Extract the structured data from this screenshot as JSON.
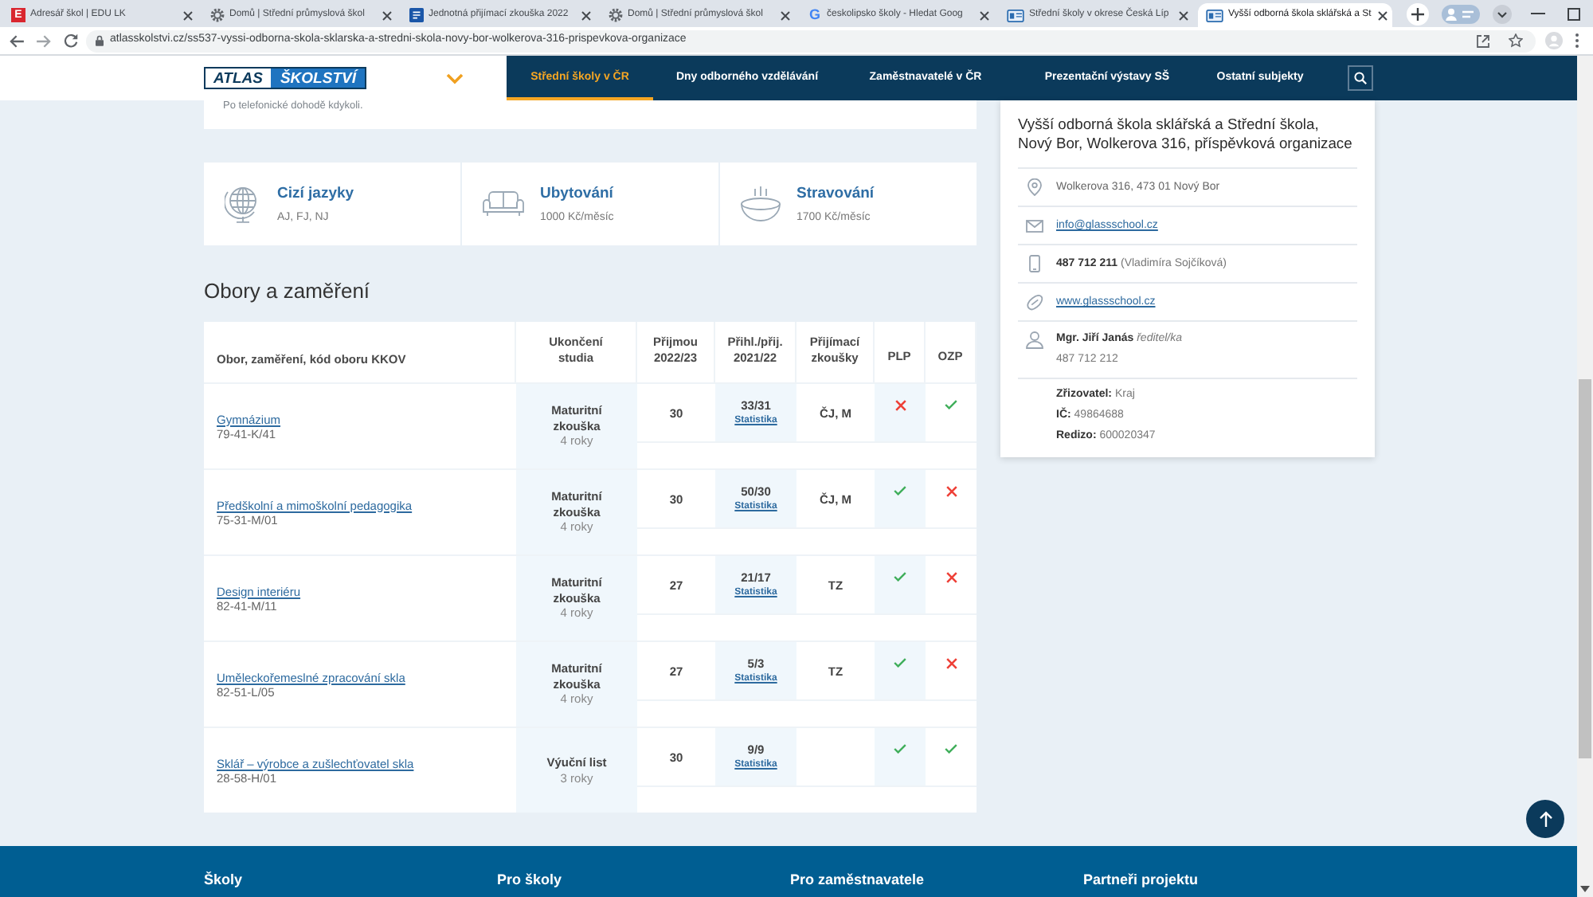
{
  "browser": {
    "tabs": [
      {
        "title": "Adresář škol | EDU LK",
        "kind": "badge",
        "icon_text": "E",
        "selected": false
      },
      {
        "title": "Domů | Střední průmyslová škol",
        "kind": "gear",
        "selected": false
      },
      {
        "title": "Jednotná přijímací zkouška 2022",
        "kind": "page",
        "selected": false
      },
      {
        "title": "Domů | Střední průmyslová škol",
        "kind": "gear",
        "selected": false
      },
      {
        "title": "českolipsko školy - Hledat Goog",
        "kind": "google",
        "icon_text": "G",
        "selected": false
      },
      {
        "title": "Střední školy v okrese Česká Líp",
        "kind": "card",
        "selected": false
      },
      {
        "title": "Vyšší odborná škola sklářská a St",
        "kind": "card",
        "selected": true
      }
    ],
    "address": "atlasskolstvi.cz/ss537-vyssi-odborna-skola-sklarska-a-stredni-skola-novy-bor-wolkerova-316-prispevkova-organizace"
  },
  "header": {
    "logo": {
      "part_1": "ATLAS",
      "part_2": "ŠKOLSTVÍ"
    },
    "menu": [
      {
        "label": "Střední školy v ČR",
        "selected": true
      },
      {
        "label": "Dny odborného vzdělávání",
        "selected": false
      },
      {
        "label": "Zaměstnavatelé v ČR",
        "selected": false
      },
      {
        "label": "Prezentační výstavy SŠ",
        "selected": false
      },
      {
        "label": "Ostatní subjekty",
        "selected": false
      }
    ]
  },
  "intro_note": "Po telefonické dohodě kdykoli.",
  "facilities": [
    {
      "kind": "languages",
      "title": "Cizí jazyky",
      "value": "AJ, FJ, NJ"
    },
    {
      "kind": "accommodation",
      "title": "Ubytování",
      "value": "1000 Kč/měsíc"
    },
    {
      "kind": "meals",
      "title": "Stravování",
      "value": "1700 Kč/měsíc"
    }
  ],
  "programs": {
    "heading": "Obory a zaměření",
    "columns": [
      "Obor, zaměření, kód oboru KKOV",
      "Ukončení studia",
      "Přijmou 2022/23",
      "Přihl./přij. 2021/22",
      "Přijímací zkoušky",
      "PLP",
      "OZP"
    ],
    "rows": [
      {
        "name": "Gymnázium",
        "code": "79-41-K/41",
        "completion": "Maturitní zkouška",
        "duration": "4 roky",
        "capacity": "30",
        "applicants": "33/31",
        "stats_link": "Statistika",
        "exams": "ČJ, M",
        "plp": false,
        "ozp": true
      },
      {
        "name": "Předškolní a mimoškolní pedagogika",
        "code": "75-31-M/01",
        "completion": "Maturitní zkouška",
        "duration": "4 roky",
        "capacity": "30",
        "applicants": "50/30",
        "stats_link": "Statistika",
        "exams": "ČJ, M",
        "plp": true,
        "ozp": false
      },
      {
        "name": "Design interiéru",
        "code": "82-41-M/11",
        "completion": "Maturitní zkouška",
        "duration": "4 roky",
        "capacity": "27",
        "applicants": "21/17",
        "stats_link": "Statistika",
        "exams": "TZ",
        "plp": true,
        "ozp": false
      },
      {
        "name": "Uměleckořemeslné zpracování skla",
        "code": "82-51-L/05",
        "completion": "Maturitní zkouška",
        "duration": "4 roky",
        "capacity": "27",
        "applicants": "5/3",
        "stats_link": "Statistika",
        "exams": "TZ",
        "plp": true,
        "ozp": false
      },
      {
        "name": "Sklář – výrobce a zušlechťovatel skla",
        "code": "28-58-H/01",
        "completion": "Výuční list",
        "duration": "3 roky",
        "capacity": "30",
        "applicants": "9/9",
        "stats_link": "Statistika",
        "plp": true,
        "ozp": true
      }
    ]
  },
  "school_card": {
    "title": "Vyšší odborná škola sklářská a Střední škola, Nový Bor, Wolkerova 316, příspěvková organizace",
    "contacts": [
      {
        "kind": "address",
        "text": "Wolkerova 316, 473 01 Nový Bor"
      },
      {
        "kind": "email",
        "text": "info@glassschool.cz"
      },
      {
        "kind": "phone",
        "text": "**487 712 211** (Vladimíra Sojčíková)"
      },
      {
        "kind": "web",
        "text": "www.glassschool.cz"
      },
      {
        "kind": "person",
        "text": "**Mgr. Jiří Janás** *ředitel/ka*",
        "phone": "487 712 212"
      }
    ],
    "details": [
      "**Zřizovatel:** Kraj",
      "**IČ:** 49864688",
      "**Redizo:** 600020347"
    ]
  },
  "footer": {
    "columns": [
      "Školy",
      "Pro školy",
      "Pro zaměstnavatele",
      "Partneři projektu"
    ]
  }
}
